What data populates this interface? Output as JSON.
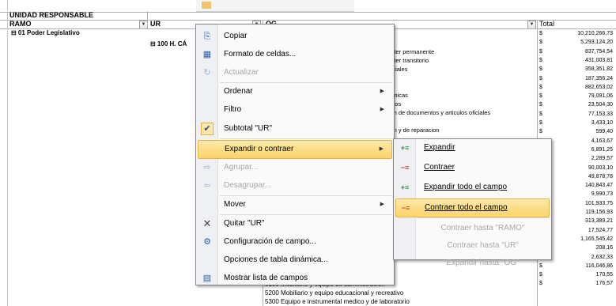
{
  "sheet": {
    "header_title": "UNIDAD RESPONSABLE",
    "col_ramo": "RAMO",
    "col_ur": "UR",
    "col_og": "OG",
    "col_total": "Total",
    "ramo_item": "⊟ 01 Poder Legislativo",
    "ur_item": "⊟ 100 H. CÁ",
    "og_items": [
      "racter permanente",
      "racter transitorio",
      "peciales",
      "",
      "nomicas",
      "blicos",
      "cion de documentos y articulos oficiales",
      "",
      "cion y de reparacion"
    ],
    "og_bottom": [
      "5100 Mobiliario y equipo de administracion",
      "5200 Mobiliario y equipo educacional y recreativo",
      "5300 Equipo e instrumental medico y de laboratorio"
    ],
    "currency": "$",
    "totals": [
      "10,210,266,73",
      "5,293,124,20",
      "837,754,54",
      "431,003,81",
      "358,351,82",
      "187,356,24",
      "882,653,02",
      "79,091,06",
      "23,504,30",
      "77,153,33",
      "3,433,10",
      "599,40",
      "4,163,67",
      "6,891,25",
      "2,289,57",
      "90,003,10",
      "49,878,78",
      "140,843,47",
      "9,990,73",
      "101,933,75",
      "119,156,93",
      "313,389,21",
      "17,524,77",
      "1,165,545,42",
      "208,16",
      "2,632,33",
      "116,046,86",
      "170,55",
      "176,57"
    ]
  },
  "menu": {
    "items": [
      {
        "label": "Copiar",
        "icon": "copy-icon",
        "glyph": "⎘",
        "disabled": false
      },
      {
        "label": "Formato de celdas...",
        "icon": "format-cells-icon",
        "glyph": "▦",
        "disabled": false
      },
      {
        "label": "Actualizar",
        "icon": "refresh-icon",
        "glyph": "↻",
        "disabled": true
      },
      {
        "label": "Ordenar",
        "icon": "",
        "glyph": "",
        "disabled": false,
        "submenu": true
      },
      {
        "label": "Filtro",
        "icon": "",
        "glyph": "",
        "disabled": false,
        "submenu": true
      },
      {
        "label": "Subtotal \"UR\"",
        "icon": "check-icon",
        "glyph": "✔",
        "disabled": false
      },
      {
        "label": "Expandir o contraer",
        "icon": "",
        "glyph": "",
        "disabled": false,
        "submenu": true,
        "highlighted": true
      },
      {
        "label": "Agrupar...",
        "icon": "group-arrow-icon",
        "glyph": "⇨",
        "disabled": true
      },
      {
        "label": "Desagrupar...",
        "icon": "ungroup-arrow-icon",
        "glyph": "⇦",
        "disabled": true
      },
      {
        "label": "Mover",
        "icon": "",
        "glyph": "",
        "disabled": false,
        "submenu": true
      },
      {
        "label": "Quitar \"UR\"",
        "icon": "remove-x-icon",
        "glyph": "✕",
        "disabled": false
      },
      {
        "label": "Configuración de campo...",
        "icon": "field-settings-icon",
        "glyph": "⚙",
        "disabled": false
      },
      {
        "label": "Opciones de tabla dinámica...",
        "icon": "",
        "glyph": "",
        "disabled": false
      },
      {
        "label": "Mostrar lista de campos",
        "icon": "field-list-icon",
        "glyph": "▤",
        "disabled": false
      }
    ]
  },
  "submenu": {
    "items": [
      {
        "label": "Expandir",
        "icon": "expand-icon",
        "glyph": "+≡",
        "disabled": false
      },
      {
        "label": "Contraer",
        "icon": "collapse-icon",
        "glyph": "−≡",
        "disabled": false
      },
      {
        "label": "Expandir todo el campo",
        "icon": "expand-all-icon",
        "glyph": "+≡",
        "disabled": false
      },
      {
        "label": "Contraer todo el campo",
        "icon": "collapse-all-icon",
        "glyph": "−≡",
        "disabled": false,
        "highlighted": true
      },
      {
        "label": "Contraer hasta \"RAMO\"",
        "icon": "",
        "glyph": "",
        "disabled": true
      },
      {
        "label": "Contraer hasta \"UR\"",
        "icon": "",
        "glyph": "",
        "disabled": true
      },
      {
        "label": "Expandir hasta \"OG\"",
        "icon": "",
        "glyph": "",
        "disabled": true
      }
    ]
  },
  "colors": {
    "highlight": "#fbd46a",
    "accent_blue": "#1f4e9c"
  }
}
